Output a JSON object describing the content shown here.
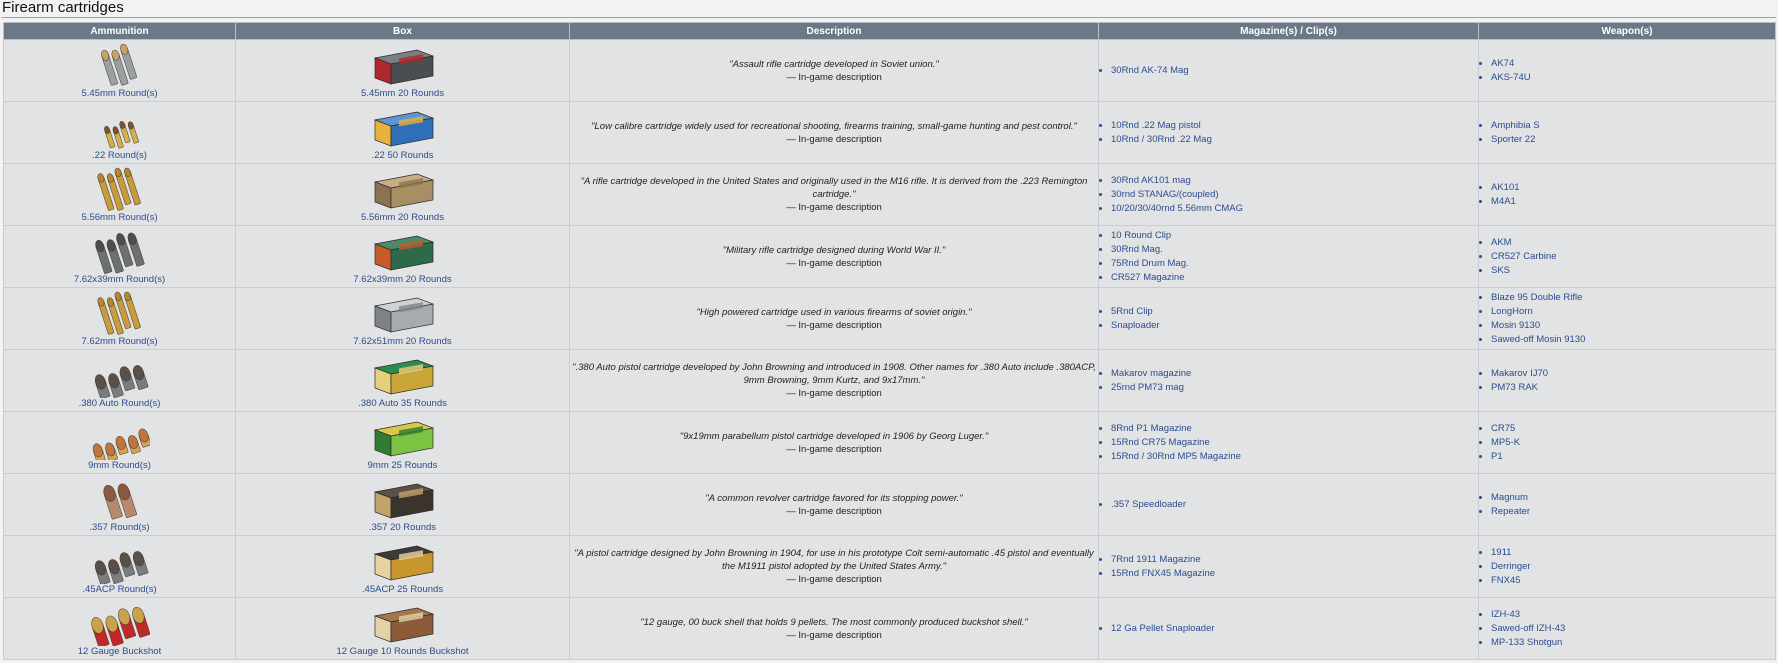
{
  "title": "Firearm cartridges",
  "headers": [
    "Ammunition",
    "Box",
    "Description",
    "Magazine(s) / Clip(s)",
    "Weapon(s)"
  ],
  "caption": "— In-game description",
  "rows": [
    {
      "ammo": "5.45mm Round(s)",
      "box": "5.45mm 20 Rounds",
      "ammo_icon": "steel-rounds-icon",
      "box_icon": "ammo-box-red-icon",
      "desc": "\"Assault rifle cartridge developed in Soviet union.\"",
      "mags": [
        "30Rnd AK-74 Mag"
      ],
      "weapons": [
        "AK74",
        "AKS-74U"
      ]
    },
    {
      "ammo": ".22 Round(s)",
      "box": ".22 50 Rounds",
      "ammo_icon": "small-rounds-icon",
      "box_icon": "ammo-box-blue-icon",
      "desc": "\"Low calibre cartridge widely used for recreational shooting, firearms training, small-game hunting and pest control.\"",
      "mags": [
        "10Rnd .22 Mag pistol",
        "10Rnd / 30Rnd .22 Mag"
      ],
      "weapons": [
        "Amphibia S",
        "Sporter 22"
      ]
    },
    {
      "ammo": "5.56mm Round(s)",
      "box": "5.56mm 20 Rounds",
      "ammo_icon": "brass-rounds-icon",
      "box_icon": "ammo-box-cardboard-icon",
      "desc": "\"A rifle cartridge developed in the United States and originally used in the M16 rifle. It is derived from the .223 Remington cartridge.\"",
      "mags": [
        "30Rnd AK101 mag",
        "30rnd STANAG/(coupled)",
        "10/20/30/40rnd 5.56mm CMAG"
      ],
      "weapons": [
        "AK101",
        "M4A1"
      ]
    },
    {
      "ammo": "7.62x39mm Round(s)",
      "box": "7.62x39mm 20 Rounds",
      "ammo_icon": "grey-rounds-icon",
      "box_icon": "ammo-box-green-icon",
      "desc": "\"Military rifle cartridge designed during World War II.\"",
      "mags": [
        "10 Round Clip",
        "30Rnd Mag.",
        "75Rnd Drum Mag.",
        "CR527 Magazine"
      ],
      "weapons": [
        "AKM",
        "CR527 Carbine",
        "SKS"
      ]
    },
    {
      "ammo": "7.62mm Round(s)",
      "box": "7.62x51mm 20 Rounds",
      "ammo_icon": "brass-rounds-icon",
      "box_icon": "ammo-box-silver-icon",
      "desc": "\"High powered cartridge used in various firearms of soviet origin.\"",
      "mags": [
        "5Rnd Clip",
        "Snaploader"
      ],
      "weapons": [
        "Blaze 95 Double Rifle",
        "LongHorn",
        "Mosin 9130",
        "Sawed-off Mosin 9130"
      ]
    },
    {
      "ammo": ".380 Auto Round(s)",
      "box": ".380 Auto 35 Rounds",
      "ammo_icon": "pistol-rounds-icon",
      "box_icon": "ammo-box-yellow-icon",
      "desc": "\".380 Auto pistol cartridge developed by John Browning and introduced in 1908. Other names for .380 Auto include .380ACP, 9mm Browning, 9mm Kurtz, and 9x17mm.\"",
      "mags": [
        "Makarov magazine",
        "25rnd PM73 mag"
      ],
      "weapons": [
        "Makarov IJ70",
        "PM73 RAK"
      ]
    },
    {
      "ammo": "9mm Round(s)",
      "box": "9mm 25 Rounds",
      "ammo_icon": "copper-rounds-icon",
      "box_icon": "ammo-box-lime-icon",
      "desc": "\"9x19mm parabellum pistol cartridge developed in 1906 by Georg Luger.\"",
      "mags": [
        "8Rnd P1 Magazine",
        "15Rnd CR75 Magazine",
        "15Rnd / 30Rnd MP5 Magazine"
      ],
      "weapons": [
        "CR75",
        "MP5-K",
        "P1"
      ]
    },
    {
      "ammo": ".357 Round(s)",
      "box": ".357 20 Rounds",
      "ammo_icon": "revolver-round-icon",
      "box_icon": "ammo-box-dark-icon",
      "desc": "\"A common revolver cartridge favored for its stopping power.\"",
      "mags": [
        ".357 Speedloader"
      ],
      "weapons": [
        "Magnum",
        "Repeater"
      ]
    },
    {
      "ammo": ".45ACP Round(s)",
      "box": ".45ACP 25 Rounds",
      "ammo_icon": "pistol-rounds-icon",
      "box_icon": "ammo-box-gold-icon",
      "desc": "\"A pistol cartridge designed by John Browning in 1904, for use in his prototype Colt semi-automatic .45 pistol and eventually the M1911 pistol adopted by the United States Army.\"",
      "mags": [
        "7Rnd 1911 Magazine",
        "15Rnd FNX45 Magazine"
      ],
      "weapons": [
        "1911",
        "Derringer",
        "FNX45"
      ]
    },
    {
      "ammo": "12 Gauge Buckshot",
      "box": "12 Gauge 10 Rounds Buckshot",
      "ammo_icon": "shotgun-shells-icon",
      "box_icon": "ammo-box-brown-icon",
      "desc": "\"12 gauge, 00 buck shell that holds 9 pellets. The most commonly produced buckshot shell.\"",
      "mags": [
        "12 Ga Pellet Snaploader"
      ],
      "weapons": [
        "IZH-43",
        "Sawed-off IZH-43",
        "MP-133 Shotgun"
      ]
    }
  ]
}
